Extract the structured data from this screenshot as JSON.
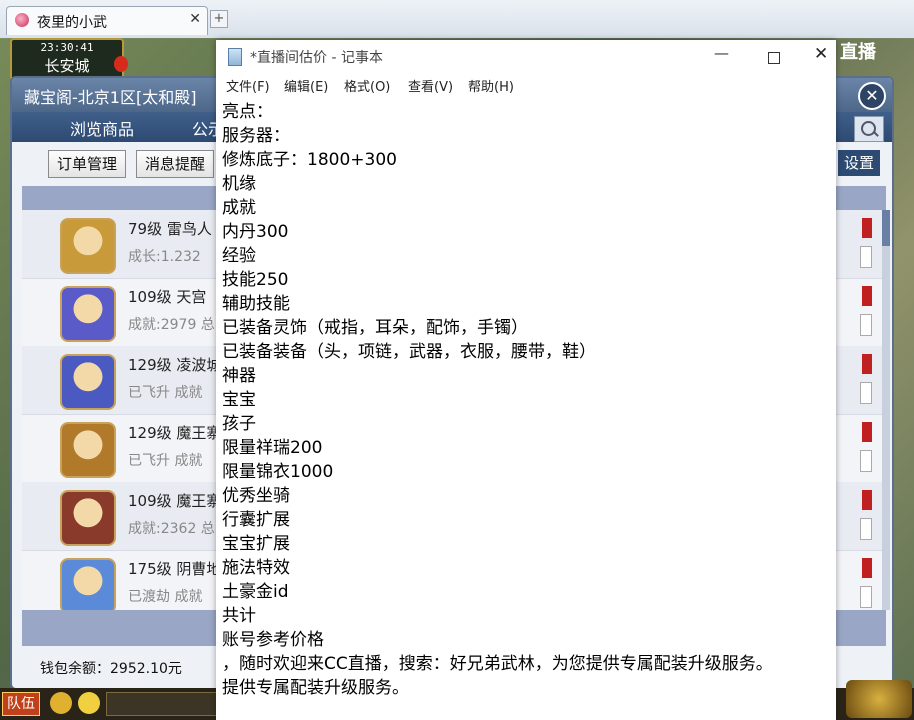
{
  "browser": {
    "tab_title": "夜里的小武",
    "tab_close": "✕",
    "new_tab": "+"
  },
  "game": {
    "time": "23:30:41",
    "city": "长安城",
    "brand": "直播",
    "brand_glyph": "⊕ ···"
  },
  "store": {
    "title": "藏宝阁-北京1区[太和殿]",
    "close": "✕",
    "nav": [
      "浏览商品",
      "公示"
    ],
    "buttons": {
      "orders": "订单管理",
      "alerts": "消息提醒",
      "settings": "设置"
    },
    "rows": [
      {
        "title": "79级 雷鸟人",
        "sub": "成长:1.232",
        "avatar_color": "#c89a3a"
      },
      {
        "title": "109级 天宫",
        "sub": "成就:2979 总",
        "avatar_color": "#5a5ac8"
      },
      {
        "title": "129级 凌波城",
        "sub": "已飞升 成就",
        "avatar_color": "#4a5ac0"
      },
      {
        "title": "129级 魔王寨",
        "sub": "已飞升 成就",
        "avatar_color": "#b07a2a"
      },
      {
        "title": "109级 魔王寨",
        "sub": "成就:2362 总",
        "avatar_color": "#8a3a2a"
      },
      {
        "title": "175级 阴曹地",
        "sub": "已渡劫 成就",
        "avatar_color": "#5a8ad8"
      }
    ],
    "wallet": "钱包余额：2952.10元"
  },
  "hud": {
    "team": "队伍"
  },
  "notepad": {
    "title": "*直播间估价 - 记事本",
    "minimize": "—",
    "close": "✕",
    "menu": [
      "文件(F)",
      "编辑(E)",
      "格式(O)",
      "查看(V)",
      "帮助(H)"
    ],
    "lines": [
      "亮点：",
      "服务器：",
      "修炼底子：1800+300",
      "机缘",
      "成就",
      "内丹300",
      "经验",
      "技能250",
      "辅助技能",
      "已装备灵饰（戒指，耳朵，配饰，手镯）",
      "已装备装备（头，项链，武器，衣服，腰带，鞋）",
      "神器",
      "宝宝",
      "孩子",
      "限量祥瑞200",
      "限量锦衣1000",
      "优秀坐骑",
      "行囊扩展",
      "宝宝扩展",
      "施法特效",
      "土豪金id",
      "共计",
      "账号参考价格",
      "，随时欢迎来CC直播，搜索：好兄弟武林，为您提供专属配装升级服务。",
      "提供专属配装升级服务。"
    ]
  }
}
